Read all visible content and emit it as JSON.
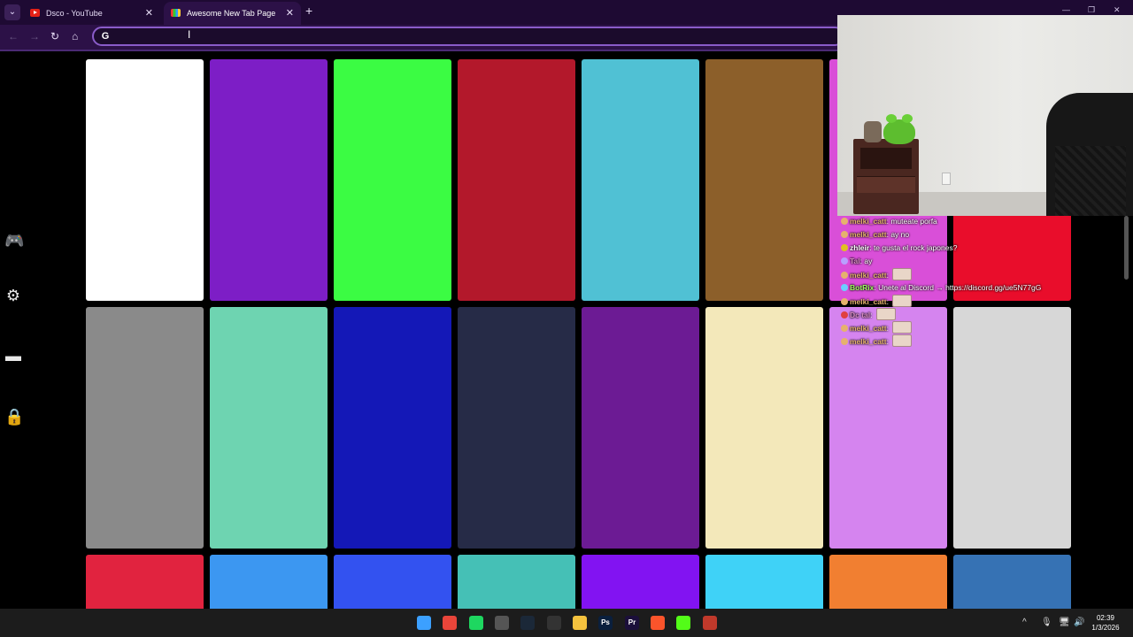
{
  "browser": {
    "tabs": [
      {
        "title": "Dsco - YouTube",
        "active": false,
        "favicon": "youtube-icon"
      },
      {
        "title": "Awesome New Tab Page",
        "active": true,
        "favicon": "new-tab-page-icon"
      }
    ],
    "new_tab_symbol": "+",
    "close_symbol": "✕",
    "omnibox": {
      "value": "",
      "engine_letter": "G"
    },
    "window_controls": [
      "—",
      "❐",
      "✕"
    ],
    "accent": "#8a5cc9",
    "frame_color": "#2c1147"
  },
  "sidebar": {
    "items": [
      {
        "name": "apps-icon",
        "glyph": "🎮"
      },
      {
        "name": "settings-icon",
        "glyph": "⚙"
      },
      {
        "name": "layout-icon",
        "glyph": "▬"
      },
      {
        "name": "lock-icon",
        "glyph": "🔒"
      }
    ]
  },
  "tiles": {
    "rows": [
      [
        "#ffffff",
        "#7d1ec6",
        "#3bfc43",
        "#b3182b",
        "#50c1d4",
        "#8c5f2a",
        "#d94fd8",
        "#e90d2b"
      ],
      [
        "#8a8a8a",
        "#6ed4b1",
        "#1418b7",
        "#262b47",
        "#6c1b94",
        "#f3e8ba",
        "#d584ef",
        "#d7d7d7"
      ],
      [
        "#e1233f",
        "#3c97f1",
        "#3352f0",
        "#45c0b6",
        "#8213f2",
        "#3fd2f7",
        "#f17f31",
        "#3672b4"
      ]
    ]
  },
  "chat": {
    "messages": [
      {
        "user": "melki_catt",
        "user_color": "#e6b26d",
        "badge_color": "#e6b26d",
        "text": "muteate porfa",
        "emote": false
      },
      {
        "user": "melki_catt",
        "user_color": "#e6b26d",
        "badge_color": "#e6b26d",
        "text": "ay no",
        "emote": false
      },
      {
        "user": "zhleir",
        "user_color": "#ffffff",
        "badge_color": "#e0c020",
        "text": "te gusta el rock japones?",
        "emote": false
      },
      {
        "user": "Tal",
        "user_color": "#d68ac0",
        "badge_color": "#b8a0ff",
        "text": "ay",
        "emote": false
      },
      {
        "user": "melki_catt",
        "user_color": "#e6b26d",
        "badge_color": "#e6b26d",
        "text": "",
        "emote": true
      },
      {
        "user": "BotRix",
        "user_color": "#9cff5a",
        "badge_color": "#6ad0ff",
        "text": "Unete al Discord → https://discord.gg/ue5N77gG",
        "emote": false
      },
      {
        "user": "melki_catt",
        "user_color": "#e6b26d",
        "badge_color": "#e6b26d",
        "text": "",
        "emote": true
      },
      {
        "user": "Dc tal",
        "user_color": "#d68ac0",
        "badge_color": "#e04040",
        "text": "",
        "emote": true
      },
      {
        "user": "melki_catt",
        "user_color": "#e6b26d",
        "badge_color": "#e6b26d",
        "text": "",
        "emote": true
      },
      {
        "user": "melki_catt",
        "user_color": "#e6b26d",
        "badge_color": "#e6b26d",
        "text": "",
        "emote": true
      }
    ]
  },
  "taskbar": {
    "apps": [
      {
        "name": "start-icon",
        "color": "#3ca0ff",
        "label": ""
      },
      {
        "name": "chrome-icon",
        "color": "#e9453a",
        "label": ""
      },
      {
        "name": "spotify-icon",
        "color": "#1ed760",
        "label": ""
      },
      {
        "name": "xbox-icon",
        "color": "#555555",
        "label": ""
      },
      {
        "name": "steam-icon",
        "color": "#1b2838",
        "label": ""
      },
      {
        "name": "obs-icon",
        "color": "#333333",
        "label": ""
      },
      {
        "name": "file-explorer-icon",
        "color": "#f4c23e",
        "label": ""
      },
      {
        "name": "photoshop-icon",
        "color": "#0a1f3d",
        "label": "Ps"
      },
      {
        "name": "premiere-icon",
        "color": "#1b0f3a",
        "label": "Pr"
      },
      {
        "name": "brave-icon",
        "color": "#fb542b",
        "label": ""
      },
      {
        "name": "kick-icon",
        "color": "#53fc18",
        "label": ""
      },
      {
        "name": "streamdeck-icon",
        "color": "#c0392b",
        "label": ""
      }
    ],
    "tray_glyphs": [
      "^",
      "🎙",
      "🖥",
      "🔊"
    ],
    "time": "02:39",
    "date": "1/3/2026"
  }
}
